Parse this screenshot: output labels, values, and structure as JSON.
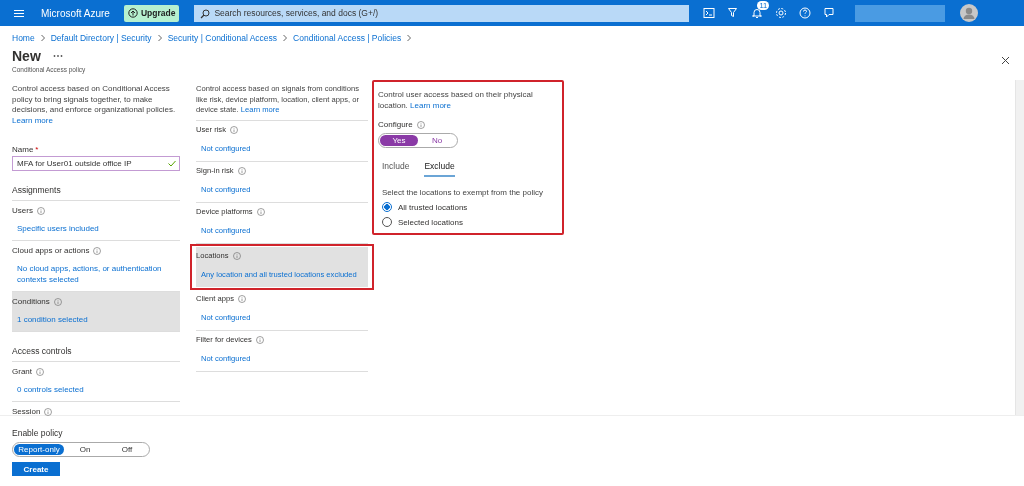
{
  "header": {
    "brand": "Microsoft Azure",
    "upgrade": "Upgrade",
    "search_placeholder": "Search resources, services, and docs (G+/)",
    "notification_count": "11"
  },
  "breadcrumb": [
    "Home",
    "Default Directory | Security",
    "Security | Conditional Access",
    "Conditional Access | Policies"
  ],
  "page": {
    "title": "New",
    "subtitle": "Conditional Access policy"
  },
  "assignments_column": {
    "intro": "Control access based on Conditional Access policy to bring signals together, to make decisions, and enforce organizational policies.",
    "learn_more": "Learn more",
    "name_field": {
      "label": "Name",
      "required": "*",
      "value": "MFA for User01 outside office IP",
      "valid": true
    },
    "groups": [
      {
        "heading": "Assignments",
        "items": [
          {
            "label": "Users",
            "value": "Specific users included",
            "selected": false
          },
          {
            "label": "Cloud apps or actions",
            "value": "No cloud apps, actions, or authentication contexts selected",
            "selected": false
          },
          {
            "label": "Conditions",
            "value": "1 condition selected",
            "selected": true
          }
        ]
      },
      {
        "heading": "Access controls",
        "items": [
          {
            "label": "Grant",
            "value": "0 controls selected",
            "selected": false
          },
          {
            "label": "Session",
            "selected": false
          }
        ]
      }
    ]
  },
  "conditions_column": {
    "intro": "Control access based on signals from conditions like risk, device platform, location, client apps, or device state.",
    "learn_more": "Learn more",
    "items": [
      {
        "label": "User risk",
        "value": "Not configured",
        "selected": false,
        "annotated": false
      },
      {
        "label": "Sign-in risk",
        "value": "Not configured",
        "selected": false,
        "annotated": false
      },
      {
        "label": "Device platforms",
        "value": "Not configured",
        "selected": false,
        "annotated": false
      },
      {
        "label": "Locations",
        "value": "Any location and all trusted locations excluded",
        "selected": true,
        "annotated": true
      },
      {
        "label": "Client apps",
        "value": "Not configured",
        "selected": false,
        "annotated": false
      },
      {
        "label": "Filter for devices",
        "value": "Not configured",
        "selected": false,
        "annotated": false
      }
    ]
  },
  "locations_panel": {
    "annotated": true,
    "intro": "Control user access based on their physical location.",
    "learn_more": "Learn more",
    "configure": {
      "label": "Configure",
      "options": [
        {
          "label": "Yes",
          "selected": true
        },
        {
          "label": "No",
          "selected": false
        }
      ]
    },
    "tabs": [
      {
        "label": "Include",
        "selected": false
      },
      {
        "label": "Exclude",
        "selected": true
      }
    ],
    "prompt": "Select the locations to exempt from the policy",
    "radios": [
      {
        "label": "All trusted locations",
        "selected": true
      },
      {
        "label": "Selected locations",
        "selected": false
      }
    ]
  },
  "enable_policy": {
    "label": "Enable policy",
    "options": [
      {
        "label": "Report-only",
        "selected": true
      },
      {
        "label": "On",
        "selected": false
      },
      {
        "label": "Off",
        "selected": false
      }
    ]
  },
  "create_button": "Create"
}
